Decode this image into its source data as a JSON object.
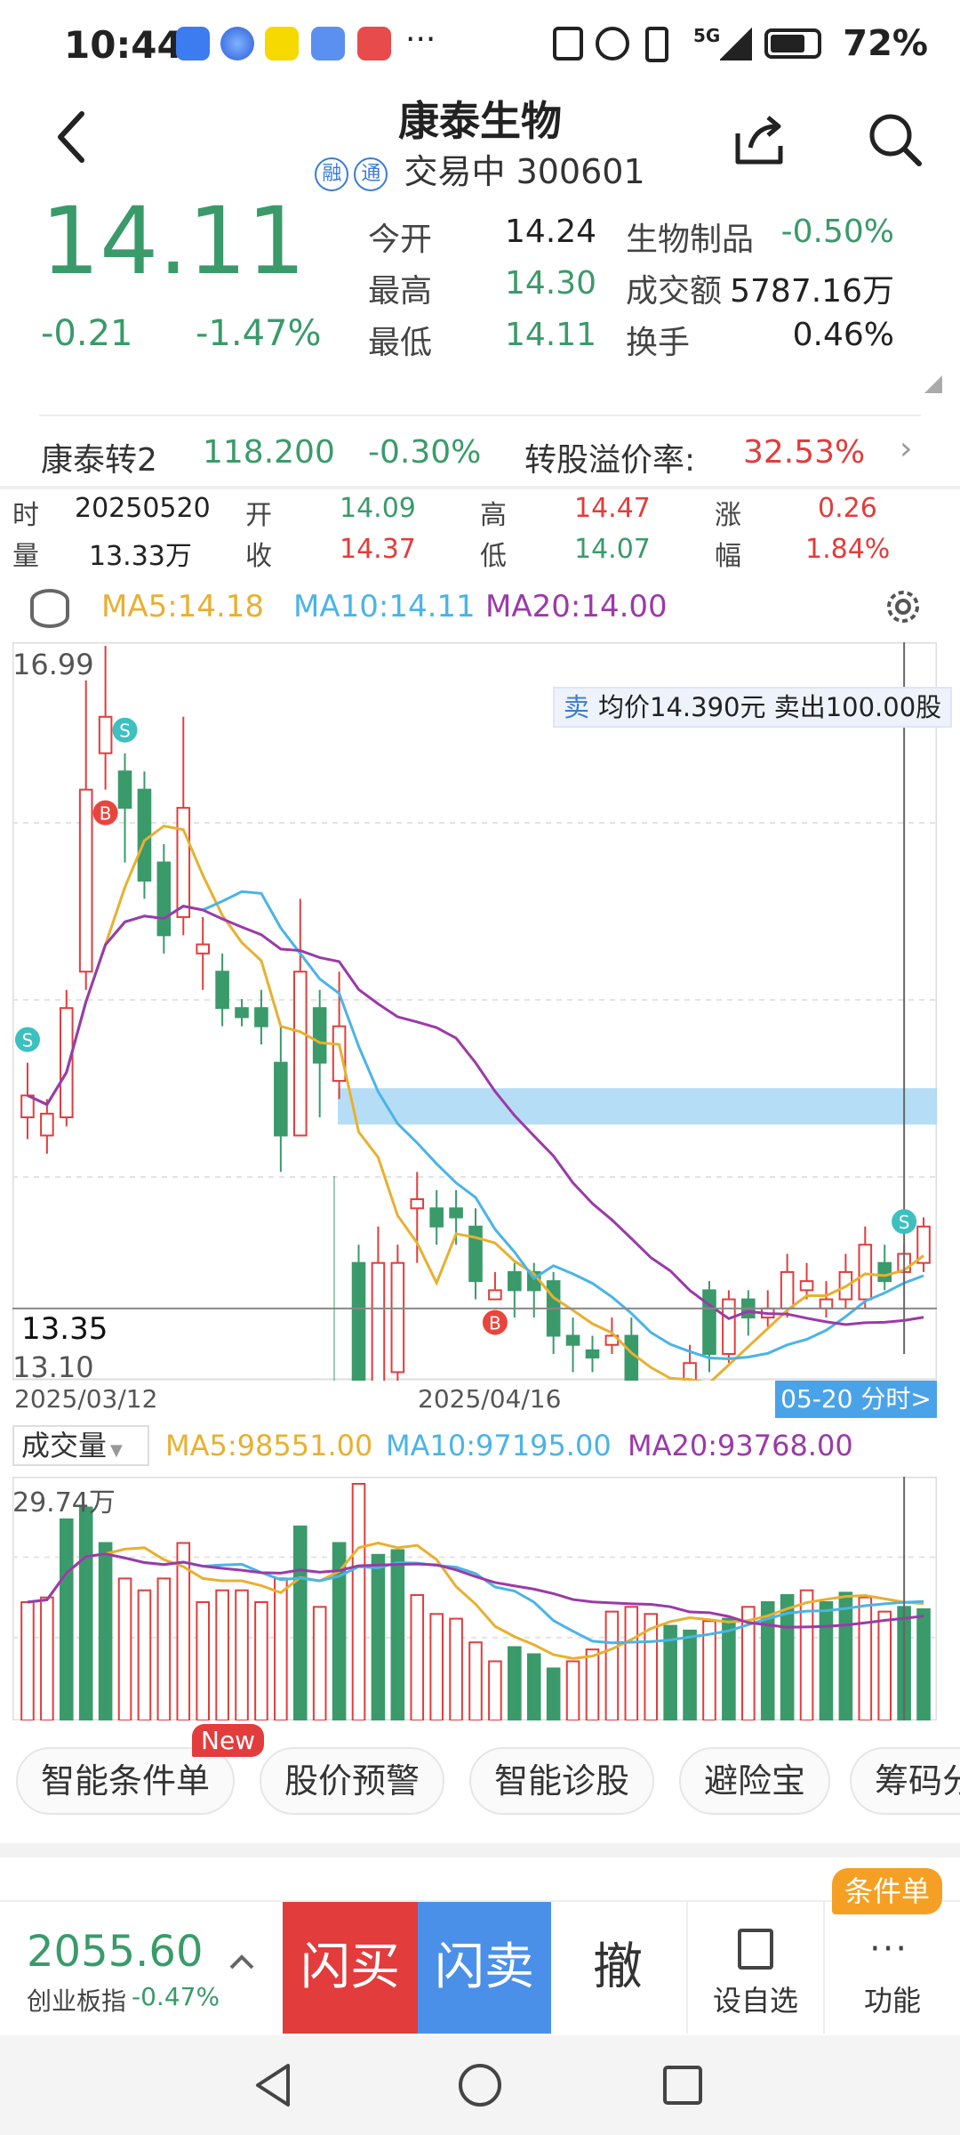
{
  "status_bar": {
    "time": "10:44",
    "battery": "72%",
    "network": "5G"
  },
  "header": {
    "title": "康泰生物",
    "tag1": "融",
    "tag2": "通",
    "state": "交易中",
    "code": "300601"
  },
  "quote": {
    "price": "14.11",
    "change": "-0.21",
    "change_pct": "-1.47%",
    "open_label": "今开",
    "open": "14.24",
    "high_label": "最高",
    "high": "14.30",
    "low_label": "最低",
    "low": "14.11",
    "sector_label": "生物制品",
    "sector_pct": "-0.50%",
    "amount_label": "成交额",
    "amount": "5787.16万",
    "turnover_label": "换手",
    "turnover": "0.46%"
  },
  "bond": {
    "name": "康泰转2",
    "price": "118.200",
    "pct": "-0.30%",
    "premium_label": "转股溢价率:",
    "premium": "32.53%"
  },
  "candle_info": {
    "time_label": "时",
    "date": "20250520",
    "open_label": "开",
    "open": "14.09",
    "high_label": "高",
    "high": "14.47",
    "rise_label": "涨",
    "rise": "0.26",
    "vol_label": "量",
    "vol": "13.33万",
    "close_label": "收",
    "close": "14.37",
    "low_label": "低",
    "low": "14.07",
    "amp_label": "幅",
    "amp": "1.84%"
  },
  "ma_legend": {
    "ma5": "MA5:14.18",
    "ma10": "MA10:14.11",
    "ma20": "MA20:14.00"
  },
  "chart_labels": {
    "y_top": "16.99",
    "y_mark": "13.35",
    "y_bottom": "13.10",
    "date_start": "2025/03/12",
    "date_mid": "2025/04/16",
    "jump": "05-20 分时>",
    "trade_tag": "卖",
    "trade_text": "均价14.390元 卖出100.00股"
  },
  "vol_legend": {
    "title": "成交量",
    "ma5": "MA5:98551.00",
    "ma10": "MA10:97195.00",
    "ma20": "MA20:93768.00",
    "max": "29.74万"
  },
  "chips": [
    {
      "label": "智能条件单",
      "badge": "New"
    },
    {
      "label": "股价预警"
    },
    {
      "label": "智能诊股"
    },
    {
      "label": "避险宝"
    },
    {
      "label": "筹码分"
    }
  ],
  "bottom": {
    "index_value": "2055.60",
    "index_name": "创业板指",
    "index_pct": "-0.47%",
    "buy": "闪买",
    "sell": "闪卖",
    "cancel": "撤",
    "watch": "设自选",
    "func": "功能",
    "func_badge": "条件单"
  },
  "colors": {
    "up": "#e23c3c",
    "down": "#3a9a6a",
    "ma5": "#e8b030",
    "ma10": "#4ab4e6",
    "ma20": "#9b3aa8",
    "buy_bg": "#e23c3c",
    "sell_bg": "#4a90e8"
  },
  "chart_data": {
    "type": "candlestick",
    "x_range": [
      "2025/03/12",
      "2025/05/20"
    ],
    "ylim": [
      13.1,
      16.99
    ],
    "candles": [
      {
        "o": 14.4,
        "c": 14.52,
        "h": 14.7,
        "l": 14.28
      },
      {
        "o": 14.3,
        "c": 14.42,
        "h": 14.5,
        "l": 14.2
      },
      {
        "o": 14.4,
        "c": 15.0,
        "h": 15.1,
        "l": 14.35
      },
      {
        "o": 15.2,
        "c": 16.2,
        "h": 16.8,
        "l": 15.1
      },
      {
        "o": 16.4,
        "c": 16.6,
        "h": 16.99,
        "l": 16.2
      },
      {
        "o": 16.3,
        "c": 16.1,
        "h": 16.4,
        "l": 15.8
      },
      {
        "o": 16.2,
        "c": 15.7,
        "h": 16.3,
        "l": 15.6
      },
      {
        "o": 15.8,
        "c": 15.4,
        "h": 15.9,
        "l": 15.3
      },
      {
        "o": 15.5,
        "c": 16.1,
        "h": 16.6,
        "l": 15.4
      },
      {
        "o": 15.3,
        "c": 15.35,
        "h": 15.5,
        "l": 15.1
      },
      {
        "o": 15.2,
        "c": 15.0,
        "h": 15.3,
        "l": 14.9
      },
      {
        "o": 15.0,
        "c": 14.95,
        "h": 15.05,
        "l": 14.9
      },
      {
        "o": 15.0,
        "c": 14.9,
        "h": 15.1,
        "l": 14.8
      },
      {
        "o": 14.7,
        "c": 14.3,
        "h": 14.9,
        "l": 14.1
      },
      {
        "o": 14.3,
        "c": 15.2,
        "h": 15.6,
        "l": 14.3
      },
      {
        "o": 15.0,
        "c": 14.7,
        "h": 15.1,
        "l": 14.4
      },
      {
        "o": 14.6,
        "c": 14.9,
        "h": 15.2,
        "l": 14.5
      },
      {
        "o": 13.6,
        "c": 12.5,
        "h": 13.7,
        "l": 12.2
      },
      {
        "o": 12.8,
        "c": 13.6,
        "h": 13.8,
        "l": 12.6
      },
      {
        "o": 13.0,
        "c": 13.6,
        "h": 13.7,
        "l": 12.55
      },
      {
        "o": 13.9,
        "c": 13.95,
        "h": 14.1,
        "l": 13.6
      },
      {
        "o": 13.9,
        "c": 13.8,
        "h": 14.0,
        "l": 13.7
      },
      {
        "o": 13.9,
        "c": 13.85,
        "h": 14.0,
        "l": 13.7
      },
      {
        "o": 13.8,
        "c": 13.5,
        "h": 13.9,
        "l": 13.4
      },
      {
        "o": 13.4,
        "c": 13.45,
        "h": 13.55,
        "l": 13.4
      },
      {
        "o": 13.55,
        "c": 13.45,
        "h": 13.6,
        "l": 13.3
      },
      {
        "o": 13.55,
        "c": 13.45,
        "h": 13.6,
        "l": 13.3
      },
      {
        "o": 13.5,
        "c": 13.2,
        "h": 13.55,
        "l": 13.1
      },
      {
        "o": 13.2,
        "c": 13.15,
        "h": 13.3,
        "l": 13.0
      },
      {
        "o": 13.12,
        "c": 13.08,
        "h": 13.2,
        "l": 13.0
      },
      {
        "o": 13.15,
        "c": 13.2,
        "h": 13.3,
        "l": 13.1
      },
      {
        "o": 13.2,
        "c": 12.9,
        "h": 13.3,
        "l": 12.85
      },
      {
        "o": 12.9,
        "c": 12.8,
        "h": 12.95,
        "l": 12.75
      },
      {
        "o": 12.8,
        "c": 12.85,
        "h": 12.95,
        "l": 12.75
      },
      {
        "o": 12.9,
        "c": 13.05,
        "h": 13.15,
        "l": 12.85
      },
      {
        "o": 13.45,
        "c": 13.1,
        "h": 13.5,
        "l": 13.0
      },
      {
        "o": 13.1,
        "c": 13.4,
        "h": 13.45,
        "l": 13.05
      },
      {
        "o": 13.4,
        "c": 13.3,
        "h": 13.45,
        "l": 13.2
      },
      {
        "o": 13.3,
        "c": 13.35,
        "h": 13.45,
        "l": 13.25
      },
      {
        "o": 13.35,
        "c": 13.55,
        "h": 13.65,
        "l": 13.3
      },
      {
        "o": 13.45,
        "c": 13.5,
        "h": 13.6,
        "l": 13.4
      },
      {
        "o": 13.35,
        "c": 13.4,
        "h": 13.5,
        "l": 13.3
      },
      {
        "o": 13.4,
        "c": 13.55,
        "h": 13.65,
        "l": 13.35
      },
      {
        "o": 13.4,
        "c": 13.7,
        "h": 13.8,
        "l": 13.35
      },
      {
        "o": 13.6,
        "c": 13.5,
        "h": 13.7,
        "l": 13.45
      },
      {
        "o": 13.55,
        "c": 13.65,
        "h": 13.7,
        "l": 13.5
      },
      {
        "o": 13.6,
        "c": 13.8,
        "h": 13.85,
        "l": 13.55
      }
    ],
    "volumes": [
      0.5,
      0.52,
      0.85,
      0.9,
      0.75,
      0.6,
      0.55,
      0.6,
      0.75,
      0.5,
      0.55,
      0.55,
      0.5,
      0.6,
      0.82,
      0.48,
      0.75,
      1.0,
      0.7,
      0.72,
      0.53,
      0.45,
      0.43,
      0.33,
      0.25,
      0.31,
      0.28,
      0.22,
      0.25,
      0.3,
      0.46,
      0.48,
      0.45,
      0.4,
      0.38,
      0.42,
      0.43,
      0.48,
      0.5,
      0.53,
      0.55,
      0.5,
      0.54,
      0.52,
      0.46,
      0.48,
      0.47
    ],
    "vol_up": [
      false,
      false,
      true,
      true,
      true,
      false,
      false,
      false,
      false,
      false,
      false,
      false,
      false,
      false,
      true,
      false,
      true,
      false,
      true,
      true,
      false,
      false,
      false,
      false,
      false,
      true,
      true,
      true,
      false,
      false,
      false,
      false,
      false,
      true,
      true,
      false,
      true,
      false,
      true,
      true,
      false,
      true,
      true,
      false,
      false,
      true,
      true
    ]
  }
}
